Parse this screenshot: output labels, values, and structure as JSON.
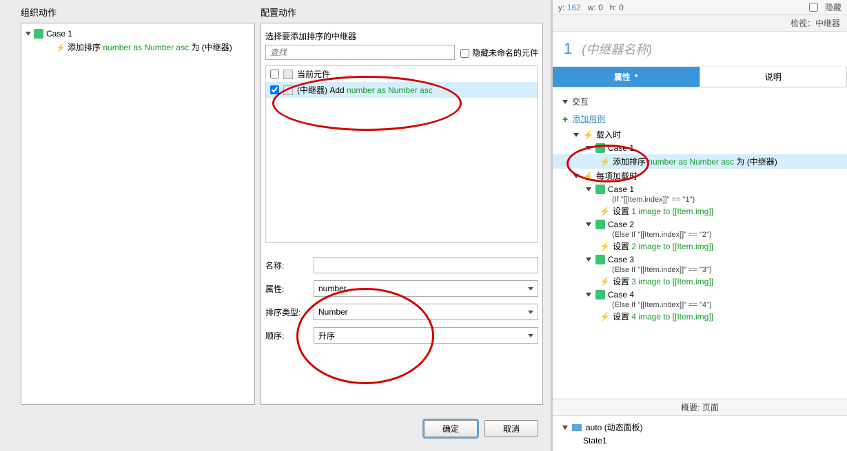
{
  "left_panel": {
    "title": "组织动作",
    "tree": {
      "case_label": "Case 1",
      "action_prefix": "添加排序",
      "action_green": " number as Number asc ",
      "action_suffix": "为 (中继器)"
    }
  },
  "right_panel": {
    "title": "配置动作",
    "select_label": "选择要添加排序的中继器",
    "search_placeholder": "查找",
    "hide_unnamed_label": "隐藏未命名的元件",
    "elements": {
      "current_widget": "当前元件",
      "repeater_prefix": "(中继器) Add ",
      "repeater_green": "number as Number asc"
    },
    "form": {
      "name_label": "名称:",
      "name_value": "",
      "property_label": "属性:",
      "property_value": "number",
      "sort_type_label": "排序类型:",
      "sort_type_value": "Number",
      "order_label": "顺序:",
      "order_value": "升序"
    }
  },
  "buttons": {
    "ok": "确定",
    "cancel": "取消"
  },
  "inspector": {
    "top": {
      "y_label": "y:",
      "y_value": "162",
      "w_label": "w:",
      "w_value": "0",
      "h_label": "h:",
      "h_value": "0",
      "hidden_label": "隐藏"
    },
    "header": "检视：中继器",
    "index": "1",
    "name_placeholder": "(中继器名称)",
    "tabs": {
      "properties": "属性",
      "dirty": "*",
      "notes": "说明"
    },
    "interactions_title": "交互",
    "add_case": "添加用例",
    "onload_label": "载入时",
    "case1": "Case 1",
    "case1_action_prefix": "添加排序",
    "case1_action_green": " number as Number asc ",
    "case1_action_suffix": "为 (中继器)",
    "itemload_label": "每项加载时",
    "cases": [
      {
        "name": "Case 1",
        "cond": "(If \"[[Item.index]]\" == \"1\")",
        "action_prefix": "设置",
        "action_green": " 1 image to [[Item.img]]"
      },
      {
        "name": "Case 2",
        "cond": "(Else If \"[[Item.index]]\" == \"2\")",
        "action_prefix": "设置",
        "action_green": " 2 image to [[Item.img]]"
      },
      {
        "name": "Case 3",
        "cond": "(Else If \"[[Item.index]]\" == \"3\")",
        "action_prefix": "设置",
        "action_green": " 3 image to [[Item.img]]"
      },
      {
        "name": "Case 4",
        "cond": "(Else If \"[[Item.index]]\" == \"4\")",
        "action_prefix": "设置",
        "action_green": " 4 image to [[Item.img]]"
      }
    ],
    "footer_title": "概要: 页面",
    "footer_item": "auto (动态面板)",
    "footer_state": "State1"
  }
}
